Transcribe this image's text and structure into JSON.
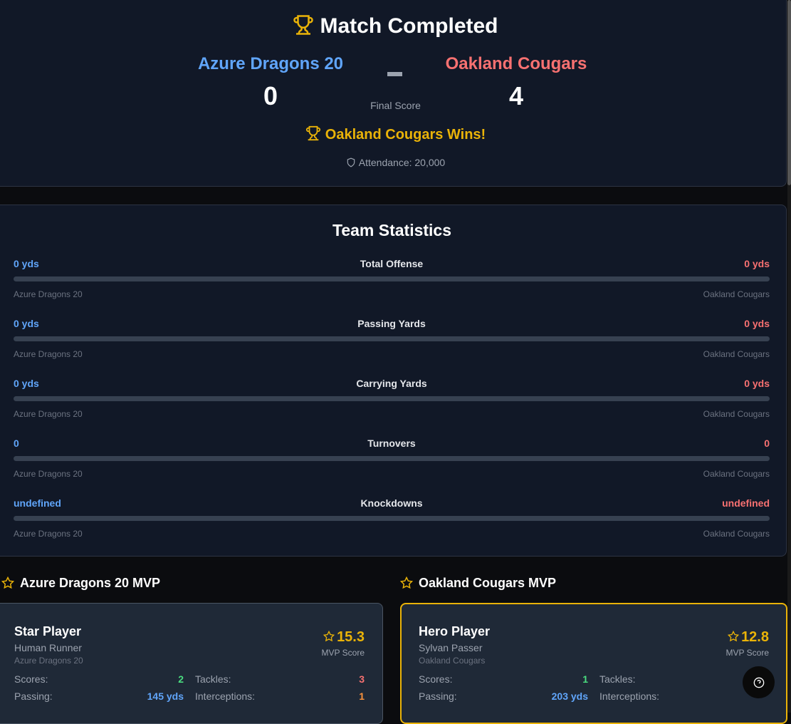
{
  "header": {
    "title": "Match Completed",
    "home_team": "Azure Dragons 20",
    "away_team": "Oakland Cougars",
    "home_score": "0",
    "away_score": "4",
    "final_label": "Final Score",
    "winner_text": "Oakland Cougars Wins!",
    "attendance": "Attendance: 20,000"
  },
  "colors": {
    "home": "#60a5fa",
    "away": "#f87171",
    "gold": "#eab308",
    "green": "#4ade80",
    "orange": "#fb923c"
  },
  "stats": {
    "title": "Team Statistics",
    "rows": [
      {
        "label": "Total Offense",
        "home": "0 yds",
        "away": "0 yds"
      },
      {
        "label": "Passing Yards",
        "home": "0 yds",
        "away": "0 yds"
      },
      {
        "label": "Carrying Yards",
        "home": "0 yds",
        "away": "0 yds"
      },
      {
        "label": "Turnovers",
        "home": "0",
        "away": "0"
      },
      {
        "label": "Knockdowns",
        "home": "undefined",
        "away": "undefined"
      }
    ],
    "home_name": "Azure Dragons 20",
    "away_name": "Oakland Cougars"
  },
  "mvp": {
    "home": {
      "heading": "Azure Dragons 20 MVP",
      "name": "Star Player",
      "type": "Human Runner",
      "team": "Azure Dragons 20",
      "score": "15.3",
      "score_label": "MVP Score",
      "scores_label": "Scores:",
      "scores": "2",
      "passing_label": "Passing:",
      "passing": "145 yds",
      "tackles_label": "Tackles:",
      "tackles": "3",
      "int_label": "Interceptions:",
      "int": "1"
    },
    "away": {
      "heading": "Oakland Cougars MVP",
      "name": "Hero Player",
      "type": "Sylvan Passer",
      "team": "Oakland Cougars",
      "score": "12.8",
      "score_label": "MVP Score",
      "scores_label": "Scores:",
      "scores": "1",
      "passing_label": "Passing:",
      "passing": "203 yds",
      "tackles_label": "Tackles:",
      "int_label": "Interceptions:"
    }
  }
}
